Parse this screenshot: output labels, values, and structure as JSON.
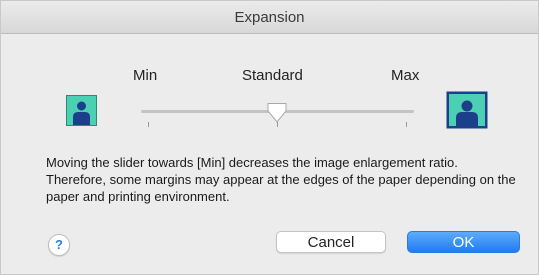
{
  "window": {
    "title": "Expansion"
  },
  "slider": {
    "min_label": "Min",
    "standard_label": "Standard",
    "max_label": "Max",
    "value": 0.5
  },
  "description": "Moving the slider towards [Min] decreases the image enlargement ratio. Therefore, some margins may appear at the edges of the paper depending on the paper and printing environment.",
  "buttons": {
    "help_label": "?",
    "cancel_label": "Cancel",
    "ok_label": "OK"
  },
  "colors": {
    "accent": "#1f7cf3",
    "icon_background": "#4bd0b4",
    "icon_figure": "#1b3f8a"
  }
}
